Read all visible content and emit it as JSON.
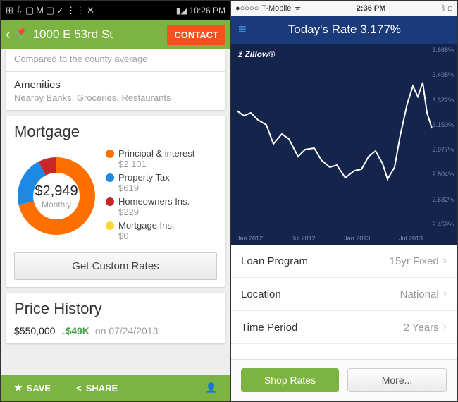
{
  "left": {
    "status": {
      "time": "10:26 PM"
    },
    "header": {
      "address": "1000 E 53rd St",
      "contact": "CONTACT"
    },
    "compare_text": "Compared to the county average",
    "amenities_title": "Amenities",
    "amenities_text": "Nearby Banks, Groceries, Restaurants",
    "mortgage": {
      "title": "Mortgage",
      "total": "$2,949",
      "period": "Monthly",
      "legend": [
        {
          "label": "Principal & interest",
          "value": "$2,101",
          "color": "#ff6f00"
        },
        {
          "label": "Property Tax",
          "value": "$619",
          "color": "#1e88e5"
        },
        {
          "label": "Homeowners Ins.",
          "value": "$229",
          "color": "#c62828"
        },
        {
          "label": "Mortgage Ins.",
          "value": "$0",
          "color": "#fdd835"
        }
      ],
      "rates_btn": "Get Custom Rates"
    },
    "price_history": {
      "title": "Price History",
      "price": "$550,000",
      "delta": "$49K",
      "date": "on 07/24/2013"
    },
    "bottom": {
      "save": "SAVE",
      "share": "SHARE"
    }
  },
  "right": {
    "status": {
      "carrier": "T-Mobile",
      "time": "2:36 PM"
    },
    "header": {
      "title": "Today's Rate 3.177%"
    },
    "logo": "Zillow",
    "settings": [
      {
        "label": "Loan Program",
        "value": "15yr Fixed"
      },
      {
        "label": "Location",
        "value": "National"
      },
      {
        "label": "Time Period",
        "value": "2 Years"
      }
    ],
    "bottom": {
      "shop": "Shop Rates",
      "more": "More..."
    }
  },
  "chart_data": {
    "type": "line",
    "title": "Today's Rate 3.177%",
    "xlabel": "",
    "ylabel": "",
    "x_categories": [
      "Jan 2012",
      "Jul 2012",
      "Jan 2013",
      "Jul 2013"
    ],
    "y_ticks": [
      "3.668%",
      "3.495%",
      "3.322%",
      "3.150%",
      "2.977%",
      "2.804%",
      "2.632%",
      "2.459%"
    ],
    "ylim": [
      2.459,
      3.668
    ],
    "series": [
      {
        "name": "15yr Fixed National",
        "x": [
          "2012-01",
          "2012-02",
          "2012-03",
          "2012-04",
          "2012-05",
          "2012-06",
          "2012-07",
          "2012-08",
          "2012-09",
          "2012-10",
          "2012-11",
          "2012-12",
          "2013-01",
          "2013-02",
          "2013-03",
          "2013-04",
          "2013-05",
          "2013-06",
          "2013-07",
          "2013-08",
          "2013-09",
          "2013-10"
        ],
        "y": [
          3.22,
          3.18,
          3.2,
          3.12,
          3.0,
          2.97,
          2.86,
          2.88,
          2.78,
          2.75,
          2.68,
          2.7,
          2.75,
          2.8,
          2.88,
          2.72,
          2.78,
          3.05,
          3.35,
          3.5,
          3.4,
          3.15
        ]
      }
    ]
  }
}
